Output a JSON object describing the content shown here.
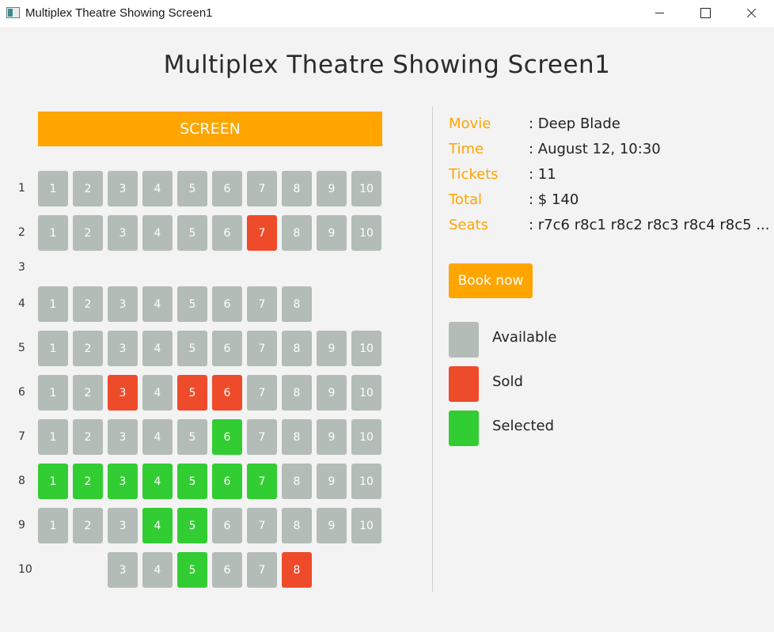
{
  "window": {
    "title": "Multiplex Theatre Showing Screen1"
  },
  "page": {
    "title": "Multiplex Theatre Showing Screen1",
    "screen_label": "SCREEN"
  },
  "colors": {
    "accent": "#ffa500",
    "available": "#b3bcb7",
    "sold": "#ee4b2b",
    "selected": "#32cd32"
  },
  "seating": {
    "rows": [
      {
        "label": "1",
        "seats": [
          {
            "n": "1",
            "s": "available"
          },
          {
            "n": "2",
            "s": "available"
          },
          {
            "n": "3",
            "s": "available"
          },
          {
            "n": "4",
            "s": "available"
          },
          {
            "n": "5",
            "s": "available"
          },
          {
            "n": "6",
            "s": "available"
          },
          {
            "n": "7",
            "s": "available"
          },
          {
            "n": "8",
            "s": "available"
          },
          {
            "n": "9",
            "s": "available"
          },
          {
            "n": "10",
            "s": "available"
          }
        ]
      },
      {
        "label": "2",
        "seats": [
          {
            "n": "1",
            "s": "available"
          },
          {
            "n": "2",
            "s": "available"
          },
          {
            "n": "3",
            "s": "available"
          },
          {
            "n": "4",
            "s": "available"
          },
          {
            "n": "5",
            "s": "available"
          },
          {
            "n": "6",
            "s": "available"
          },
          {
            "n": "7",
            "s": "sold"
          },
          {
            "n": "8",
            "s": "available"
          },
          {
            "n": "9",
            "s": "available"
          },
          {
            "n": "10",
            "s": "available"
          }
        ]
      },
      {
        "label": "3",
        "seats": []
      },
      {
        "label": "4",
        "seats": [
          {
            "n": "1",
            "s": "available"
          },
          {
            "n": "2",
            "s": "available"
          },
          {
            "n": "3",
            "s": "available"
          },
          {
            "n": "4",
            "s": "available"
          },
          {
            "n": "5",
            "s": "available"
          },
          {
            "n": "6",
            "s": "available"
          },
          {
            "n": "7",
            "s": "available"
          },
          {
            "n": "8",
            "s": "available"
          }
        ]
      },
      {
        "label": "5",
        "seats": [
          {
            "n": "1",
            "s": "available"
          },
          {
            "n": "2",
            "s": "available"
          },
          {
            "n": "3",
            "s": "available"
          },
          {
            "n": "4",
            "s": "available"
          },
          {
            "n": "5",
            "s": "available"
          },
          {
            "n": "6",
            "s": "available"
          },
          {
            "n": "7",
            "s": "available"
          },
          {
            "n": "8",
            "s": "available"
          },
          {
            "n": "9",
            "s": "available"
          },
          {
            "n": "10",
            "s": "available"
          }
        ]
      },
      {
        "label": "6",
        "seats": [
          {
            "n": "1",
            "s": "available"
          },
          {
            "n": "2",
            "s": "available"
          },
          {
            "n": "3",
            "s": "sold"
          },
          {
            "n": "4",
            "s": "available"
          },
          {
            "n": "5",
            "s": "sold"
          },
          {
            "n": "6",
            "s": "sold"
          },
          {
            "n": "7",
            "s": "available"
          },
          {
            "n": "8",
            "s": "available"
          },
          {
            "n": "9",
            "s": "available"
          },
          {
            "n": "10",
            "s": "available"
          }
        ]
      },
      {
        "label": "7",
        "seats": [
          {
            "n": "1",
            "s": "available"
          },
          {
            "n": "2",
            "s": "available"
          },
          {
            "n": "3",
            "s": "available"
          },
          {
            "n": "4",
            "s": "available"
          },
          {
            "n": "5",
            "s": "available"
          },
          {
            "n": "6",
            "s": "selected"
          },
          {
            "n": "7",
            "s": "available"
          },
          {
            "n": "8",
            "s": "available"
          },
          {
            "n": "9",
            "s": "available"
          },
          {
            "n": "10",
            "s": "available"
          }
        ]
      },
      {
        "label": "8",
        "seats": [
          {
            "n": "1",
            "s": "selected"
          },
          {
            "n": "2",
            "s": "selected"
          },
          {
            "n": "3",
            "s": "selected"
          },
          {
            "n": "4",
            "s": "selected"
          },
          {
            "n": "5",
            "s": "selected"
          },
          {
            "n": "6",
            "s": "selected"
          },
          {
            "n": "7",
            "s": "selected"
          },
          {
            "n": "8",
            "s": "available"
          },
          {
            "n": "9",
            "s": "available"
          },
          {
            "n": "10",
            "s": "available"
          }
        ]
      },
      {
        "label": "9",
        "seats": [
          {
            "n": "1",
            "s": "available"
          },
          {
            "n": "2",
            "s": "available"
          },
          {
            "n": "3",
            "s": "available"
          },
          {
            "n": "4",
            "s": "selected"
          },
          {
            "n": "5",
            "s": "selected"
          },
          {
            "n": "6",
            "s": "available"
          },
          {
            "n": "7",
            "s": "available"
          },
          {
            "n": "8",
            "s": "available"
          },
          {
            "n": "9",
            "s": "available"
          },
          {
            "n": "10",
            "s": "available"
          }
        ]
      },
      {
        "label": "10",
        "seats": [
          {
            "n": "3",
            "s": "available"
          },
          {
            "n": "4",
            "s": "available"
          },
          {
            "n": "5",
            "s": "selected"
          },
          {
            "n": "6",
            "s": "available"
          },
          {
            "n": "7",
            "s": "available"
          },
          {
            "n": "8",
            "s": "sold"
          }
        ]
      }
    ]
  },
  "info": {
    "movie_label": "Movie",
    "movie_value": ": Deep Blade",
    "time_label": "Time",
    "time_value": ": August 12, 10:30",
    "tickets_label": "Tickets",
    "tickets_value": ": 11",
    "total_label": "Total",
    "total_value": ": $ 140",
    "seats_label": "Seats",
    "seats_value": ": r7c6 r8c1 r8c2 r8c3 r8c4 r8c5 ..."
  },
  "book_button": "Book now",
  "legend": {
    "available": "Available",
    "sold": "Sold",
    "selected": "Selected"
  }
}
